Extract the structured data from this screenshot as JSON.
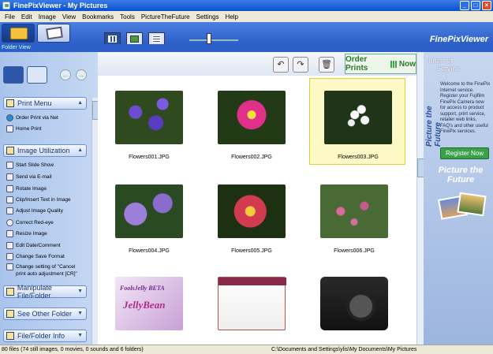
{
  "window": {
    "title": "FinePixViewer  - My Pictures"
  },
  "menu": [
    "File",
    "Edit",
    "Image",
    "View",
    "Bookmarks",
    "Tools",
    "PictureTheFuture",
    "Settings",
    "Help"
  ],
  "brand": "FinePixViewer",
  "folder_view_label": "Folder View",
  "left": {
    "sections": [
      {
        "label": "Print Menu",
        "icon": "printer-icon"
      },
      {
        "label": "Image Utilization",
        "icon": "image-icon"
      },
      {
        "label": "Manipulate File/Folder",
        "icon": "folder-icon"
      },
      {
        "label": "See Other Folder",
        "icon": "folder-icon"
      },
      {
        "label": "File/Folder Info",
        "icon": "info-icon"
      }
    ],
    "print_items": [
      "Order Print via Net",
      "Home Print"
    ],
    "util_items": [
      "Start Slide Show",
      "Send via E-mail",
      "Rotate Image",
      "Clip/Insert Text in Image",
      "Adjust Image Quality",
      "Correct Red-eye",
      "Resize Image",
      "Edit Date/Comment",
      "Change Save Format",
      "Change setting of  \"Cancel",
      "print auto adjustment [CR]\""
    ]
  },
  "main": {
    "order_prints": "Order Prints",
    "order_now": "Now",
    "thumbnails": [
      {
        "caption": "Flowers001.JPG"
      },
      {
        "caption": "Flowers002.JPG"
      },
      {
        "caption": "Flowers003.JPG"
      },
      {
        "caption": "Flowers004.JPG"
      },
      {
        "caption": "Flowers005.JPG"
      },
      {
        "caption": "Flowers006.JPG"
      },
      {
        "caption": "",
        "line1": "FoolsJelly BETA",
        "line2": "JellyBean"
      },
      {
        "caption": ""
      },
      {
        "caption": ""
      }
    ]
  },
  "right": {
    "header1": "Internet",
    "header2": "Service",
    "vertical": "Picture the Future",
    "text": "Welcome to the FinePix Internet service. Register your Fujifilm FinePix Camera now for access to product support, print service, retailer web links, FAQ's and other useful FinePix services.",
    "register": "Register Now",
    "picture_future": "Picture the Future"
  },
  "status": {
    "left": "80 files (74 still images, 0 movies, 0 sounds and 6 folders)",
    "path": "C:\\Documents and Settings\\ylis\\My Documents\\My Pictures"
  }
}
